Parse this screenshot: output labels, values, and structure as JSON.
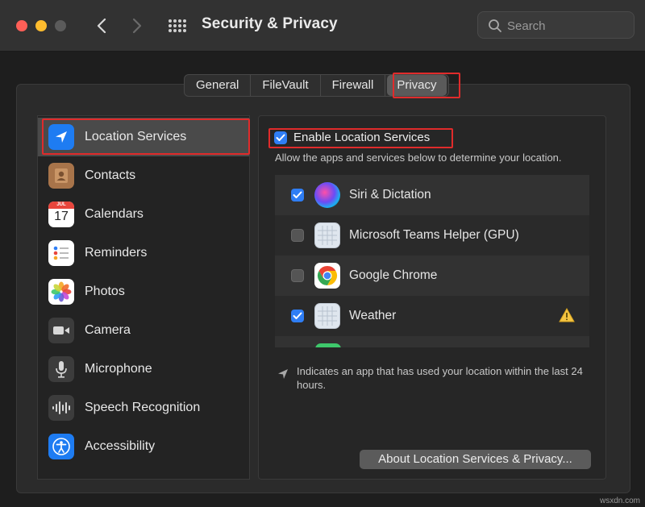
{
  "window": {
    "title": "Security & Privacy",
    "search_placeholder": "Search"
  },
  "tabs": [
    {
      "label": "General",
      "selected": false
    },
    {
      "label": "FileVault",
      "selected": false
    },
    {
      "label": "Firewall",
      "selected": false
    },
    {
      "label": "Privacy",
      "selected": true
    }
  ],
  "sidebar": {
    "items": [
      {
        "label": "Location Services",
        "icon": "location-arrow-icon",
        "selected": true
      },
      {
        "label": "Contacts",
        "icon": "contacts-book-icon"
      },
      {
        "label": "Calendars",
        "icon": "calendar-icon",
        "calendar_month": "JUL",
        "calendar_day": "17"
      },
      {
        "label": "Reminders",
        "icon": "reminders-list-icon"
      },
      {
        "label": "Photos",
        "icon": "photos-flower-icon"
      },
      {
        "label": "Camera",
        "icon": "camera-icon"
      },
      {
        "label": "Microphone",
        "icon": "microphone-icon"
      },
      {
        "label": "Speech Recognition",
        "icon": "waveform-icon"
      },
      {
        "label": "Accessibility",
        "icon": "accessibility-icon"
      }
    ]
  },
  "location": {
    "enable_label": "Enable Location Services",
    "enabled": true,
    "description": "Allow the apps and services below to determine your location.",
    "apps": [
      {
        "name": "Siri & Dictation",
        "checked": true,
        "icon": "siri-icon"
      },
      {
        "name": "Microsoft Teams Helper (GPU)",
        "checked": false,
        "icon": "generic-app-icon"
      },
      {
        "name": "Google Chrome",
        "checked": false,
        "icon": "chrome-icon"
      },
      {
        "name": "Weather",
        "checked": true,
        "icon": "generic-app-icon",
        "warning": true
      }
    ],
    "note": "Indicates an app that has used your location within the last 24 hours.",
    "about_button": "About Location Services & Privacy..."
  },
  "watermark": "wsxdn.com",
  "colors": {
    "highlight": "#e02b2b",
    "checkbox_blue": "#2f7ef5",
    "location_blue": "#1e7cf2"
  }
}
